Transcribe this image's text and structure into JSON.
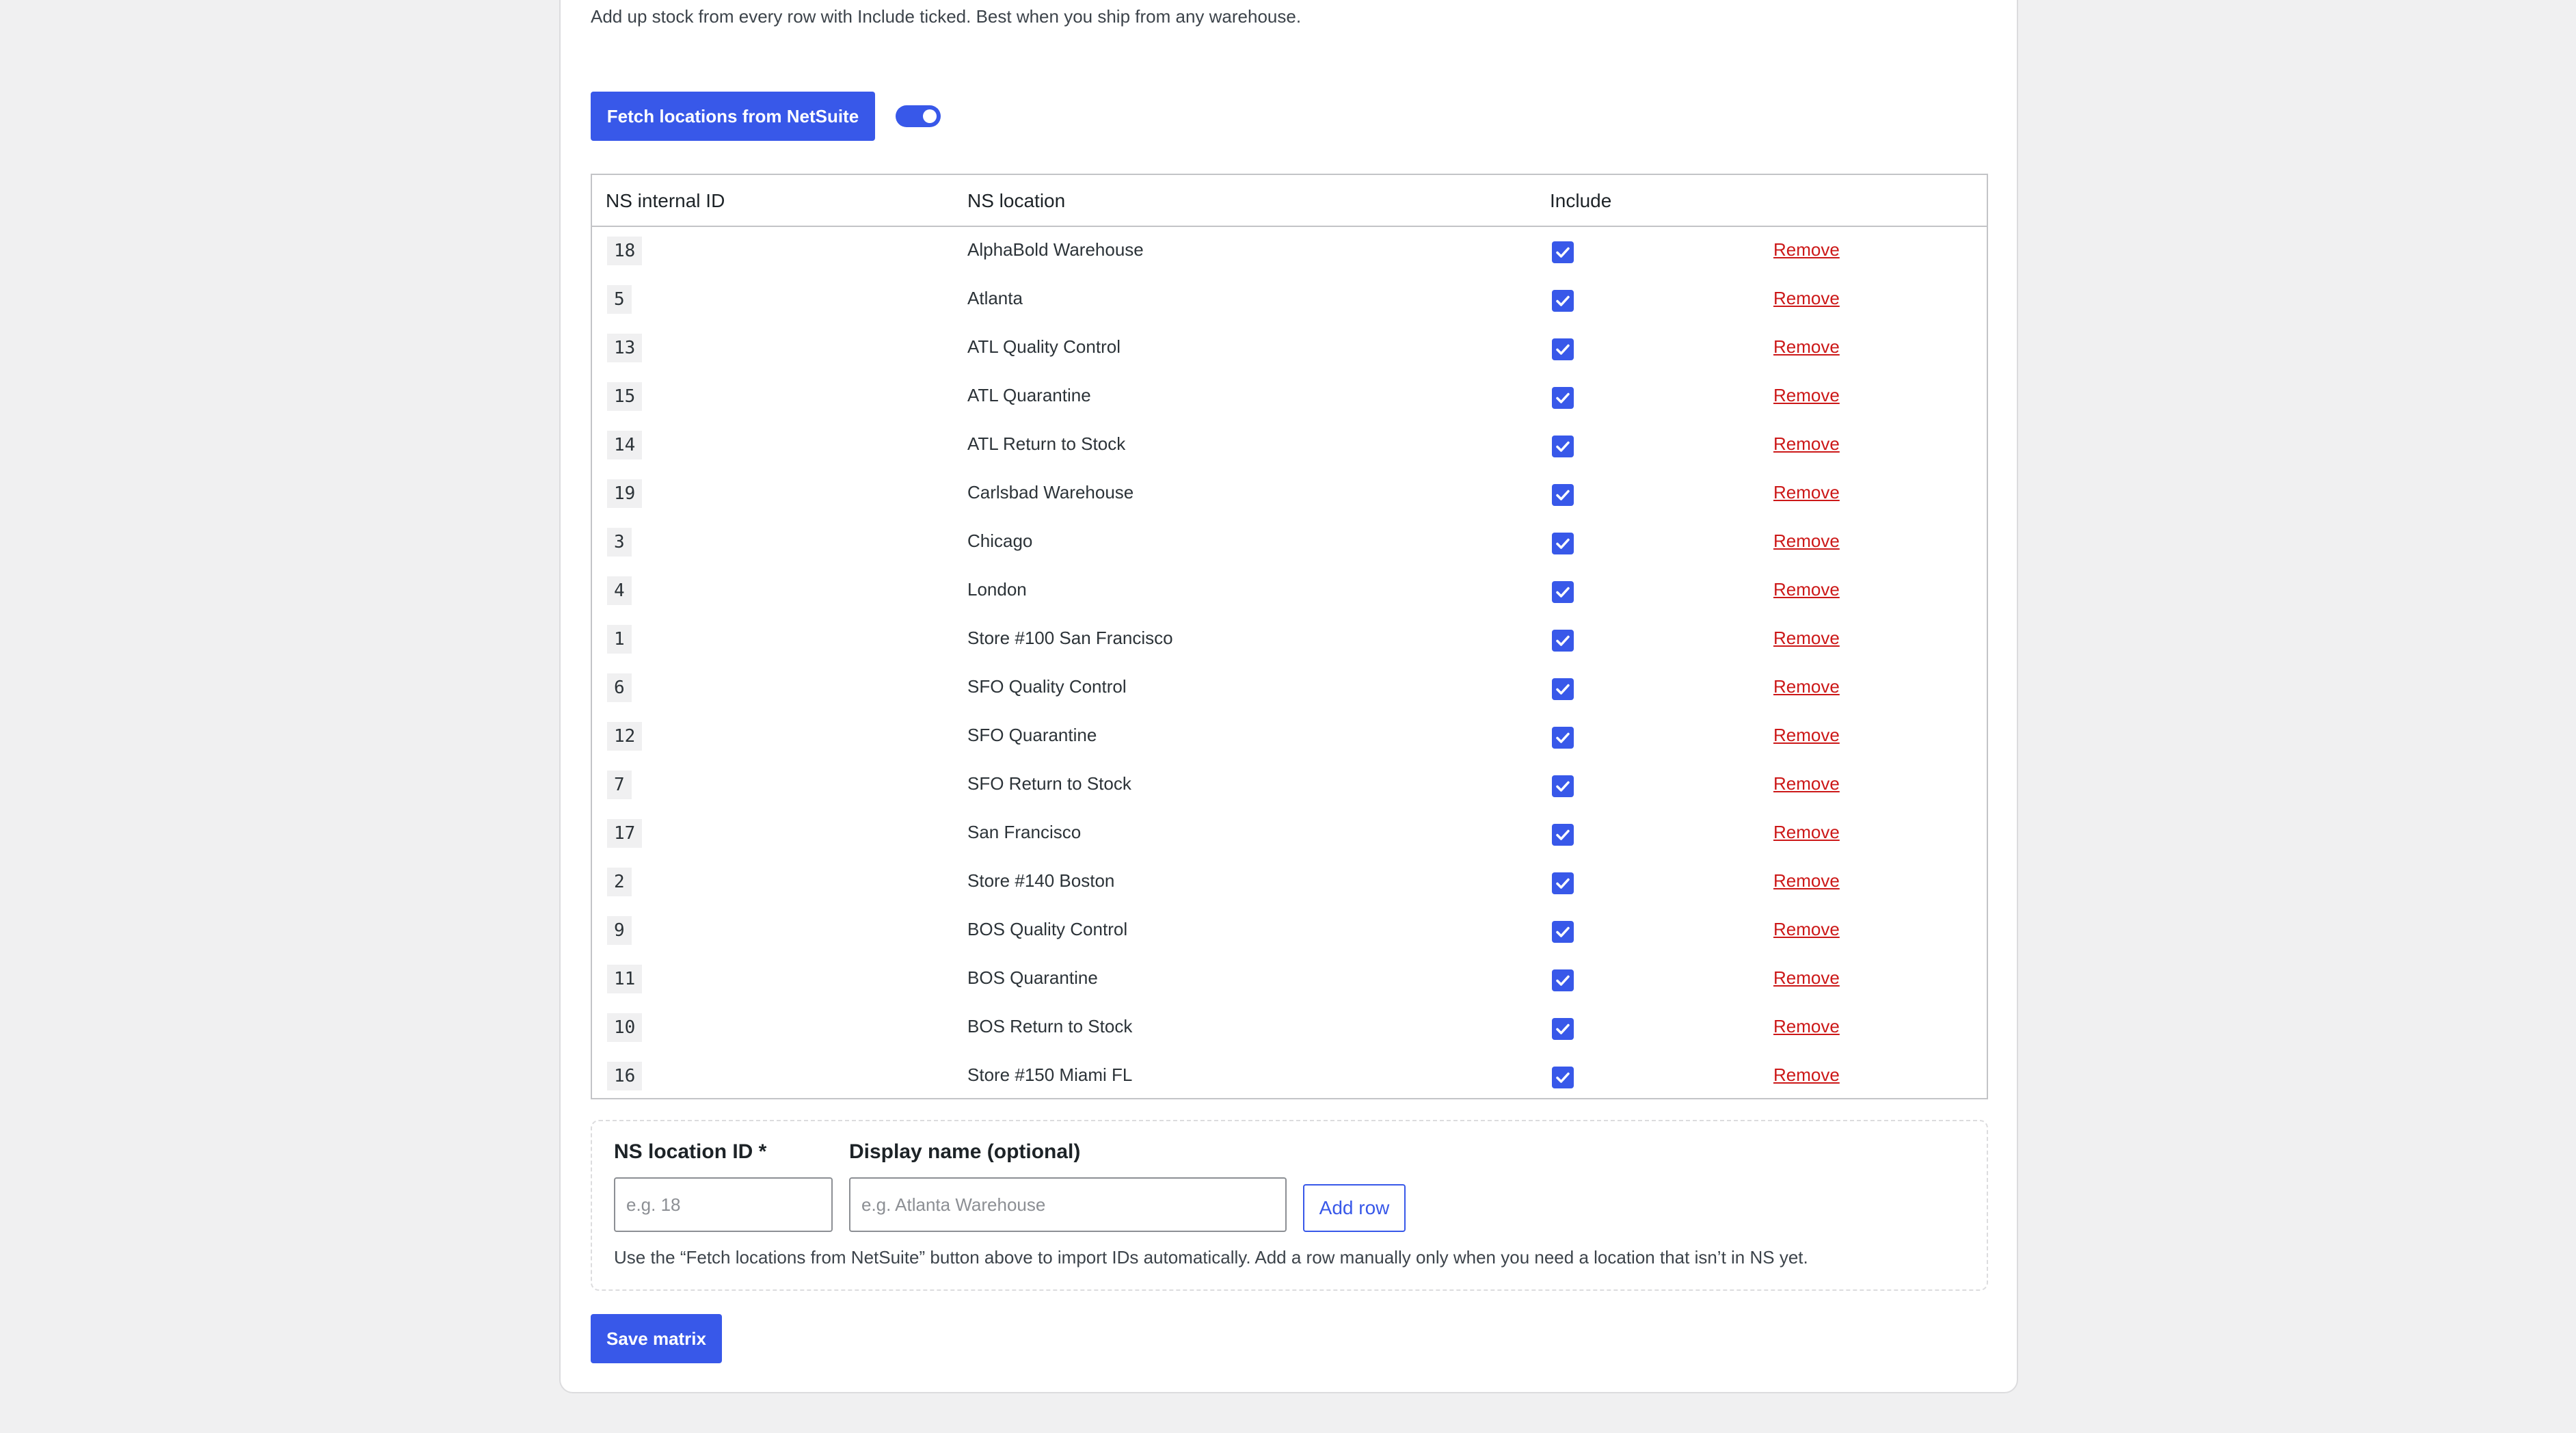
{
  "intro": {
    "description": "Add up stock from every row with Include ticked. Best when you ship from any warehouse."
  },
  "toolbar": {
    "fetch_label": "Fetch locations from NetSuite",
    "toggle_on": true
  },
  "table": {
    "headers": {
      "id": "NS internal ID",
      "location": "NS location",
      "include": "Include"
    },
    "remove_label": "Remove",
    "rows": [
      {
        "id": "18",
        "location": "AlphaBold Warehouse",
        "include": true
      },
      {
        "id": "5",
        "location": "Atlanta",
        "include": true
      },
      {
        "id": "13",
        "location": "ATL Quality Control",
        "include": true
      },
      {
        "id": "15",
        "location": "ATL Quarantine",
        "include": true
      },
      {
        "id": "14",
        "location": "ATL Return to Stock",
        "include": true
      },
      {
        "id": "19",
        "location": "Carlsbad Warehouse",
        "include": true
      },
      {
        "id": "3",
        "location": "Chicago",
        "include": true
      },
      {
        "id": "4",
        "location": "London",
        "include": true
      },
      {
        "id": "1",
        "location": "Store #100 San Francisco",
        "include": true
      },
      {
        "id": "6",
        "location": "SFO Quality Control",
        "include": true
      },
      {
        "id": "12",
        "location": "SFO Quarantine",
        "include": true
      },
      {
        "id": "7",
        "location": "SFO Return to Stock",
        "include": true
      },
      {
        "id": "17",
        "location": "San Francisco",
        "include": true
      },
      {
        "id": "2",
        "location": "Store #140 Boston",
        "include": true
      },
      {
        "id": "9",
        "location": "BOS Quality Control",
        "include": true
      },
      {
        "id": "11",
        "location": "BOS Quarantine",
        "include": true
      },
      {
        "id": "10",
        "location": "BOS Return to Stock",
        "include": true
      },
      {
        "id": "16",
        "location": "Store #150 Miami FL",
        "include": true
      }
    ]
  },
  "add_form": {
    "id_label": "NS location ID *",
    "id_placeholder": "e.g. 18",
    "name_label": "Display name (optional)",
    "name_placeholder": "e.g. Atlanta Warehouse",
    "add_button_label": "Add row",
    "help_text": "Use the “Fetch locations from NetSuite” button above to import IDs automatically. Add a row manually only when you need a location that isn’t in NS yet."
  },
  "footer": {
    "save_label": "Save matrix"
  },
  "colors": {
    "accent": "#3858e9",
    "danger": "#cc1818",
    "background": "#f0f0f1"
  }
}
